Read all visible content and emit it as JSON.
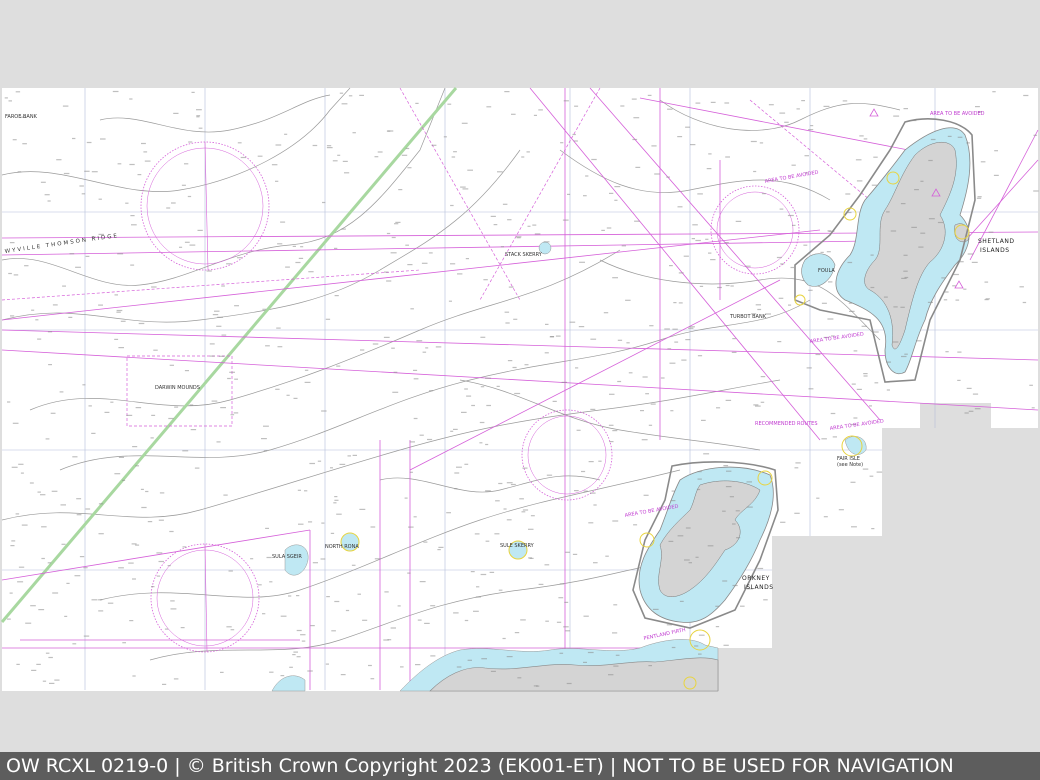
{
  "footer": {
    "text": "OW RCXL 0219-0 | © British Crown Copyright 2023 (EK001-ET) | NOT TO BE USED FOR NAVIGATION"
  },
  "map_labels": {
    "shetland": "SHETLAND",
    "shetland_islands": "ISLANDS",
    "orkney": "ORKNEY",
    "orkney_islands": "ISLANDS",
    "darwin_mounds": "DARWIN MOUNDS",
    "ridge": "WYVILLE THOMSON RIDGE",
    "faroe_bank": "FAROE BANK",
    "area_avoided_1": "AREA TO BE AVOIDED",
    "area_avoided_2": "AREA TO BE AVOIDED",
    "area_avoided_3": "AREA TO BE AVOIDED",
    "area_avoided_4": "AREA TO BE AVOIDED",
    "area_avoided_5": "AREA TO BE AVOIDED",
    "recommended_routes": "RECOMMENDED ROUTES",
    "fair_isle": "FAIR ISLE",
    "foula": "FOULA",
    "fair_isle_sub": "(see Note)",
    "turbot_bank": "TURBOT BANK",
    "pentland": "PENTLAND FIRTH",
    "north_rona": "NORTH RONA",
    "sula_sgeir": "SULA SGEIR",
    "sule_skerry": "SULE SKERRY",
    "stack_skerry": "STACK SKERRY"
  },
  "colors": {
    "sea": "#ffffff",
    "shallow": "#bfe8f3",
    "land": "#d4d4d4",
    "magenta": "#d35bd6",
    "grid": "#9aa5c9",
    "contour": "#8c8c8c",
    "cable": "#9fd49a",
    "footer_bg": "#5d5d5d"
  }
}
